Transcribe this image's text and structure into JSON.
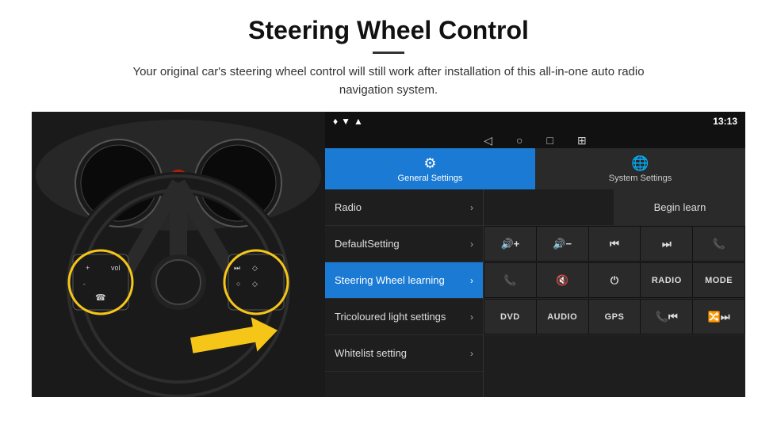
{
  "header": {
    "title": "Steering Wheel Control",
    "subtitle": "Your original car's steering wheel control will still work after installation of this all-in-one auto radio navigation system."
  },
  "status_bar": {
    "time": "13:13",
    "location_icon": "📍",
    "signal_icon": "▼",
    "wifi_icon": "▲"
  },
  "nav_bar": {
    "back": "◁",
    "home": "○",
    "square": "□",
    "apps": "⊞"
  },
  "tabs": [
    {
      "id": "general",
      "label": "General Settings",
      "icon": "⚙",
      "active": true
    },
    {
      "id": "system",
      "label": "System Settings",
      "icon": "🌐",
      "active": false
    }
  ],
  "menu": [
    {
      "id": "radio",
      "label": "Radio",
      "active": false
    },
    {
      "id": "default",
      "label": "DefaultSetting",
      "active": false
    },
    {
      "id": "steering",
      "label": "Steering Wheel learning",
      "active": true
    },
    {
      "id": "tricoloured",
      "label": "Tricoloured light settings",
      "active": false
    },
    {
      "id": "whitelist",
      "label": "Whitelist setting",
      "active": false
    }
  ],
  "controls": {
    "begin_learn": "Begin learn",
    "row1": [
      "🔊+",
      "🔊-",
      "⏮",
      "⏭",
      "📞"
    ],
    "row2": [
      "📞",
      "🔇",
      "⏻",
      "RADIO",
      "MODE"
    ],
    "row3": [
      "DVD",
      "AUDIO",
      "GPS",
      "📞⏮",
      "🔀⏭"
    ]
  }
}
